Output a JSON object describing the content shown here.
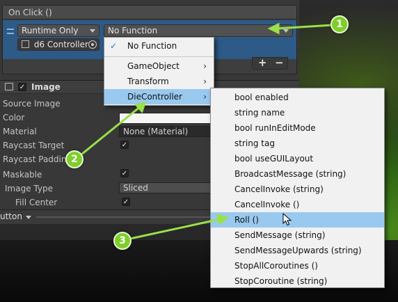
{
  "onclick": {
    "title": "On Click ()",
    "runtime_mode": "Runtime Only",
    "function_value": "No Function",
    "target_object": "d6 Controller",
    "add_label": "+",
    "remove_label": "−"
  },
  "image_component": {
    "title": "Image",
    "properties": [
      {
        "label": "Source Image",
        "value": ""
      },
      {
        "label": "Color",
        "value": ""
      },
      {
        "label": "Material",
        "value": "None (Material)"
      },
      {
        "label": "Raycast Target",
        "value": "✓"
      },
      {
        "label": "Raycast Paddin",
        "value": ""
      },
      {
        "label": "Maskable",
        "value": "✓"
      },
      {
        "label": "Image Type",
        "value": "Sliced"
      },
      {
        "label": "Fill Center",
        "value": "✓"
      }
    ]
  },
  "button_bar": {
    "label": "utton"
  },
  "main_menu": {
    "items": [
      {
        "label": "No Function",
        "checked": true
      },
      {
        "label": "GameObject",
        "submenu": true
      },
      {
        "label": "Transform",
        "submenu": true
      },
      {
        "label": "DieController",
        "submenu": true,
        "highlighted": true
      }
    ]
  },
  "submenu": {
    "items": [
      "bool enabled",
      "string name",
      "bool runInEditMode",
      "string tag",
      "bool useGUILayout",
      "BroadcastMessage (string)",
      "CancelInvoke (string)",
      "CancelInvoke ()",
      "Roll ()",
      "SendMessage (string)",
      "SendMessageUpwards (string)",
      "StopAllCoroutines ()",
      "StopCoroutine (string)"
    ],
    "highlighted_index": 8
  },
  "callouts": [
    "1",
    "2",
    "3"
  ],
  "colors": {
    "callout": "#7fce2b",
    "menu_highlight": "#99c9ef",
    "event_row": "#2d5a86"
  }
}
